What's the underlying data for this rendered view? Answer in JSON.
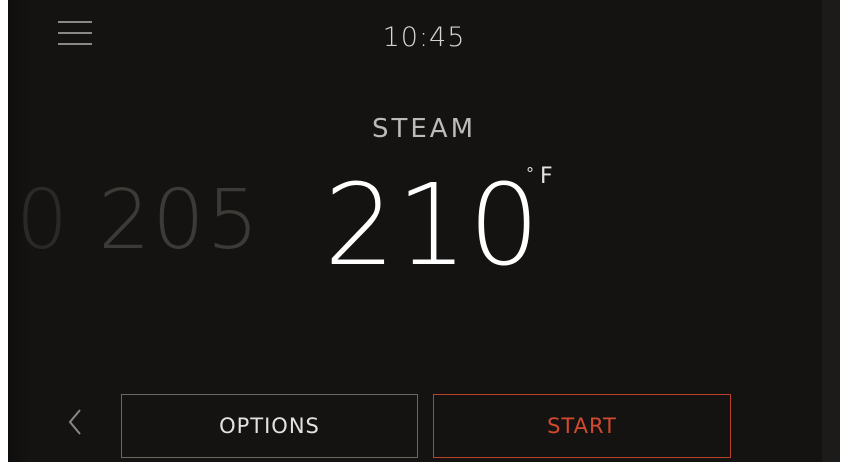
{
  "header": {
    "time": "10:45",
    "menu_icon": "hamburger-menu-icon"
  },
  "main": {
    "mode": "STEAM",
    "temperature_previous": "205",
    "temperature_previous_partial": "0",
    "temperature_current": "210",
    "unit_degree": "°",
    "unit_letter": "F"
  },
  "footer": {
    "back_icon": "chevron-left-icon",
    "options_label": "OPTIONS",
    "start_label": "START"
  },
  "colors": {
    "background": "#151311",
    "accent": "#d2492f",
    "options_border": "#6b6864"
  }
}
